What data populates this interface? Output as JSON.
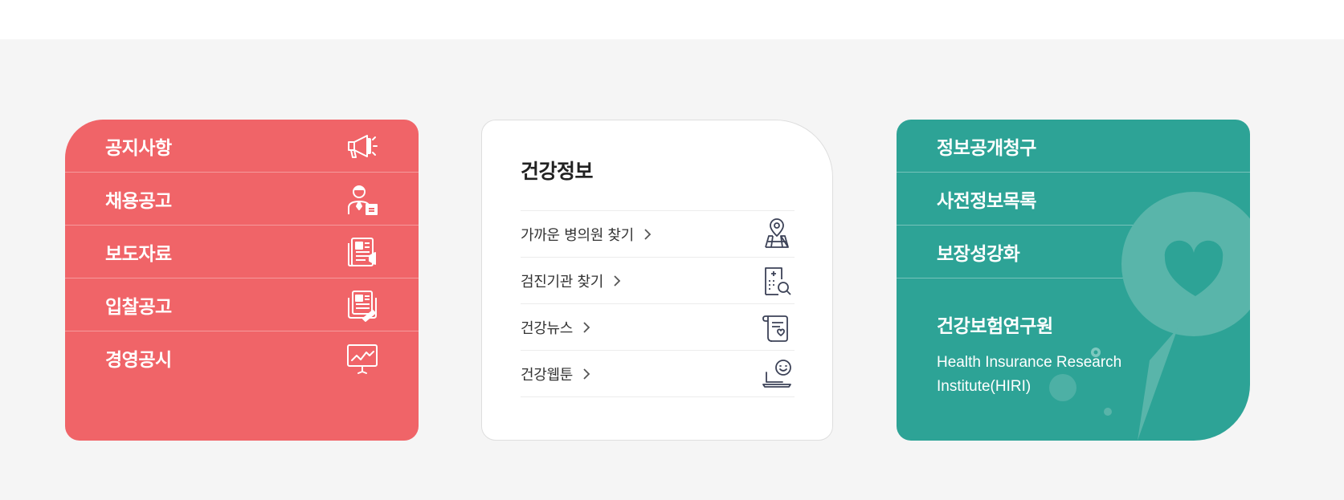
{
  "colors": {
    "red_card": "#f06468",
    "teal_card": "#2da396",
    "background": "#f5f5f5"
  },
  "red_card": {
    "items": [
      {
        "label": "공지사항",
        "icon": "megaphone-icon"
      },
      {
        "label": "채용공고",
        "icon": "recruit-person-icon"
      },
      {
        "label": "보도자료",
        "icon": "press-release-icon"
      },
      {
        "label": "입찰공고",
        "icon": "bid-document-icon"
      },
      {
        "label": "경영공시",
        "icon": "presentation-chart-icon"
      }
    ]
  },
  "white_card": {
    "title": "건강정보",
    "items": [
      {
        "label": "가까운 병의원 찾기",
        "icon": "map-pin-icon"
      },
      {
        "label": "검진기관 찾기",
        "icon": "hospital-search-icon"
      },
      {
        "label": "건강뉴스",
        "icon": "news-scroll-icon"
      },
      {
        "label": "건강웹툰",
        "icon": "laptop-smile-icon"
      }
    ]
  },
  "teal_card": {
    "items": [
      {
        "label": "정보공개청구"
      },
      {
        "label": "사전정보목록"
      },
      {
        "label": "보장성강화"
      }
    ],
    "research": {
      "title": "건강보험연구원",
      "subtitle": "Health Insurance Research Institute(HIRI)",
      "icon": "heart-bubble-icon"
    }
  }
}
